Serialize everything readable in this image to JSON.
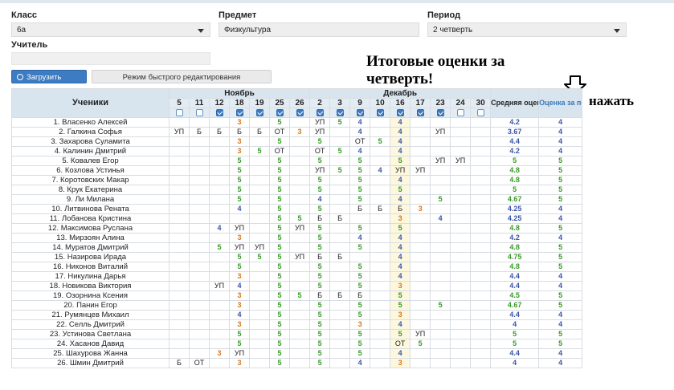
{
  "filters": {
    "class_label": "Класс",
    "class_value": "6а",
    "subject_label": "Предмет",
    "subject_value": "Физкультура",
    "period_label": "Период",
    "period_value": "2 четверть",
    "teacher_label": "Учитель"
  },
  "buttons": {
    "load": "Загрузить",
    "quick_edit": "Режим быстрого редактирования"
  },
  "annotation": {
    "line1": "Итоговые оценки за",
    "line2": "четверть!",
    "press": "нажать"
  },
  "table": {
    "students_header": "Ученики",
    "months": [
      {
        "name": "Ноябрь",
        "span": 7
      },
      {
        "name": "Декабрь",
        "span": 9
      }
    ],
    "days": [
      "5",
      "11",
      "12",
      "18",
      "19",
      "25",
      "26",
      "2",
      "3",
      "9",
      "10",
      "16",
      "17",
      "23",
      "24",
      "30"
    ],
    "checked": [
      false,
      false,
      true,
      true,
      true,
      true,
      true,
      true,
      true,
      true,
      true,
      true,
      true,
      true,
      false,
      false
    ],
    "highlight_col": 11,
    "avg_header": "Средняя оценка",
    "final_header": "Оценка за период",
    "rows": [
      {
        "name": "1. Власенко Алексей",
        "g": [
          "",
          "",
          "",
          "3",
          "",
          "5",
          "",
          "УП",
          "5",
          "4",
          "",
          "4",
          "",
          "",
          "",
          ""
        ],
        "avg": "4.2",
        "final": "4"
      },
      {
        "name": "2. Галкина Софья",
        "g": [
          "УП",
          "Б",
          "Б",
          "Б",
          "Б",
          "ОТ",
          "3",
          "УП",
          "",
          "4",
          "",
          "4",
          "",
          "УП",
          "",
          ""
        ],
        "avg": "3.67",
        "final": "4"
      },
      {
        "name": "3. Захарова Суламита",
        "g": [
          "",
          "",
          "",
          "3",
          "",
          "5",
          "",
          "5",
          "",
          "ОТ",
          "5",
          "4",
          "",
          "",
          "",
          ""
        ],
        "avg": "4.4",
        "final": "4"
      },
      {
        "name": "4. Калинин Дмитрий",
        "g": [
          "",
          "",
          "",
          "3",
          "5",
          "ОТ",
          "",
          "ОТ",
          "5",
          "4",
          "",
          "4",
          "",
          "",
          "",
          ""
        ],
        "avg": "4.2",
        "final": "4"
      },
      {
        "name": "5. Ковалев Егор",
        "g": [
          "",
          "",
          "",
          "5",
          "",
          "5",
          "",
          "5",
          "",
          "5",
          "",
          "5",
          "",
          "УП",
          "УП",
          ""
        ],
        "avg": "5",
        "final": "5"
      },
      {
        "name": "6. Козлова Устинья",
        "g": [
          "",
          "",
          "",
          "5",
          "",
          "5",
          "",
          "УП",
          "5",
          "5",
          "4",
          "УП",
          "УП",
          "",
          "",
          ""
        ],
        "avg": "4.8",
        "final": "5"
      },
      {
        "name": "7. Коротовских Макар",
        "g": [
          "",
          "",
          "",
          "5",
          "",
          "5",
          "",
          "5",
          "",
          "5",
          "",
          "4",
          "",
          "",
          "",
          ""
        ],
        "avg": "4.8",
        "final": "5"
      },
      {
        "name": "8. Крук Екатерина",
        "g": [
          "",
          "",
          "",
          "5",
          "",
          "5",
          "",
          "5",
          "",
          "5",
          "",
          "5",
          "",
          "",
          "",
          ""
        ],
        "avg": "5",
        "final": "5"
      },
      {
        "name": "9. Ли Милана",
        "g": [
          "",
          "",
          "",
          "5",
          "",
          "5",
          "",
          "4",
          "",
          "5",
          "",
          "4",
          "",
          "5",
          "",
          ""
        ],
        "avg": "4.67",
        "final": "5"
      },
      {
        "name": "10. Литвинова Рената",
        "g": [
          "",
          "",
          "",
          "4",
          "",
          "5",
          "",
          "5",
          "",
          "Б",
          "Б",
          "Б",
          "3",
          "",
          "",
          ""
        ],
        "avg": "4.25",
        "final": "4"
      },
      {
        "name": "11. Лобанова Кристина",
        "g": [
          "",
          "",
          "",
          "",
          "",
          "5",
          "5",
          "Б",
          "Б",
          "",
          "",
          "3",
          "",
          "4",
          "",
          ""
        ],
        "avg": "4.25",
        "final": "4"
      },
      {
        "name": "12. Максимова Руслана",
        "g": [
          "",
          "",
          "4",
          "УП",
          "",
          "5",
          "УП",
          "5",
          "",
          "5",
          "",
          "5",
          "",
          "",
          "",
          ""
        ],
        "avg": "4.8",
        "final": "5"
      },
      {
        "name": "13. Мирзоян Алина",
        "g": [
          "",
          "",
          "",
          "3",
          "",
          "5",
          "",
          "5",
          "",
          "4",
          "",
          "4",
          "",
          "",
          "",
          ""
        ],
        "avg": "4.2",
        "final": "4"
      },
      {
        "name": "14. Муратов Дмитрий",
        "g": [
          "",
          "",
          "5",
          "УП",
          "УП",
          "5",
          "",
          "5",
          "",
          "5",
          "",
          "4",
          "",
          "",
          "",
          ""
        ],
        "avg": "4.8",
        "final": "5"
      },
      {
        "name": "15. Назирова Ирада",
        "g": [
          "",
          "",
          "",
          "5",
          "5",
          "5",
          "УП",
          "Б",
          "Б",
          "",
          "",
          "4",
          "",
          "",
          "",
          ""
        ],
        "avg": "4.75",
        "final": "5"
      },
      {
        "name": "16. Никонов Виталий",
        "g": [
          "",
          "",
          "",
          "5",
          "",
          "5",
          "",
          "5",
          "",
          "5",
          "",
          "4",
          "",
          "",
          "",
          ""
        ],
        "avg": "4.8",
        "final": "5"
      },
      {
        "name": "17. Никулина Дарья",
        "g": [
          "",
          "",
          "",
          "3",
          "",
          "5",
          "",
          "5",
          "",
          "5",
          "",
          "4",
          "",
          "",
          "",
          ""
        ],
        "avg": "4.4",
        "final": "4"
      },
      {
        "name": "18. Новикова Виктория",
        "g": [
          "",
          "",
          "УП",
          "4",
          "",
          "5",
          "",
          "5",
          "",
          "5",
          "",
          "3",
          "",
          "",
          "",
          ""
        ],
        "avg": "4.4",
        "final": "4"
      },
      {
        "name": "19. Озорнина Ксения",
        "g": [
          "",
          "",
          "",
          "3",
          "",
          "5",
          "5",
          "Б",
          "Б",
          "Б",
          "",
          "5",
          "",
          "",
          "",
          ""
        ],
        "avg": "4.5",
        "final": "5"
      },
      {
        "name": "20. Панин Егор",
        "g": [
          "",
          "",
          "",
          "3",
          "",
          "5",
          "",
          "5",
          "",
          "5",
          "",
          "5",
          "",
          "5",
          "",
          ""
        ],
        "avg": "4.67",
        "final": "5"
      },
      {
        "name": "21. Румянцев Михаил",
        "g": [
          "",
          "",
          "",
          "4",
          "",
          "5",
          "",
          "5",
          "",
          "5",
          "",
          "3",
          "",
          "",
          "",
          ""
        ],
        "avg": "4.4",
        "final": "4"
      },
      {
        "name": "22. Селль Дмитрий",
        "g": [
          "",
          "",
          "",
          "3",
          "",
          "5",
          "",
          "5",
          "",
          "3",
          "",
          "4",
          "",
          "",
          "",
          ""
        ],
        "avg": "4",
        "final": "4"
      },
      {
        "name": "23. Устинова Светлана",
        "g": [
          "",
          "",
          "",
          "5",
          "",
          "5",
          "",
          "5",
          "",
          "5",
          "",
          "5",
          "УП",
          "",
          "",
          ""
        ],
        "avg": "5",
        "final": "5"
      },
      {
        "name": "24. Хасанов Давид",
        "g": [
          "",
          "",
          "",
          "5",
          "",
          "5",
          "",
          "5",
          "",
          "5",
          "",
          "ОТ",
          "5",
          "",
          "",
          ""
        ],
        "avg": "5",
        "final": "5"
      },
      {
        "name": "25. Шахурова Жанна",
        "g": [
          "",
          "",
          "3",
          "УП",
          "",
          "5",
          "",
          "5",
          "",
          "5",
          "",
          "4",
          "",
          "",
          "",
          ""
        ],
        "avg": "4.4",
        "final": "4"
      },
      {
        "name": "26. Шмин Дмитрий",
        "g": [
          "Б",
          "ОТ",
          "",
          "3",
          "",
          "5",
          "",
          "5",
          "",
          "4",
          "",
          "3",
          "",
          "",
          "",
          ""
        ],
        "avg": "4",
        "final": "4"
      }
    ]
  },
  "colors": {
    "grade5": "#3a9a2a",
    "grade4": "#3b55a8",
    "grade3": "#d8781f",
    "accent": "#3d7cc2",
    "highlight": "#fdf8dd"
  }
}
